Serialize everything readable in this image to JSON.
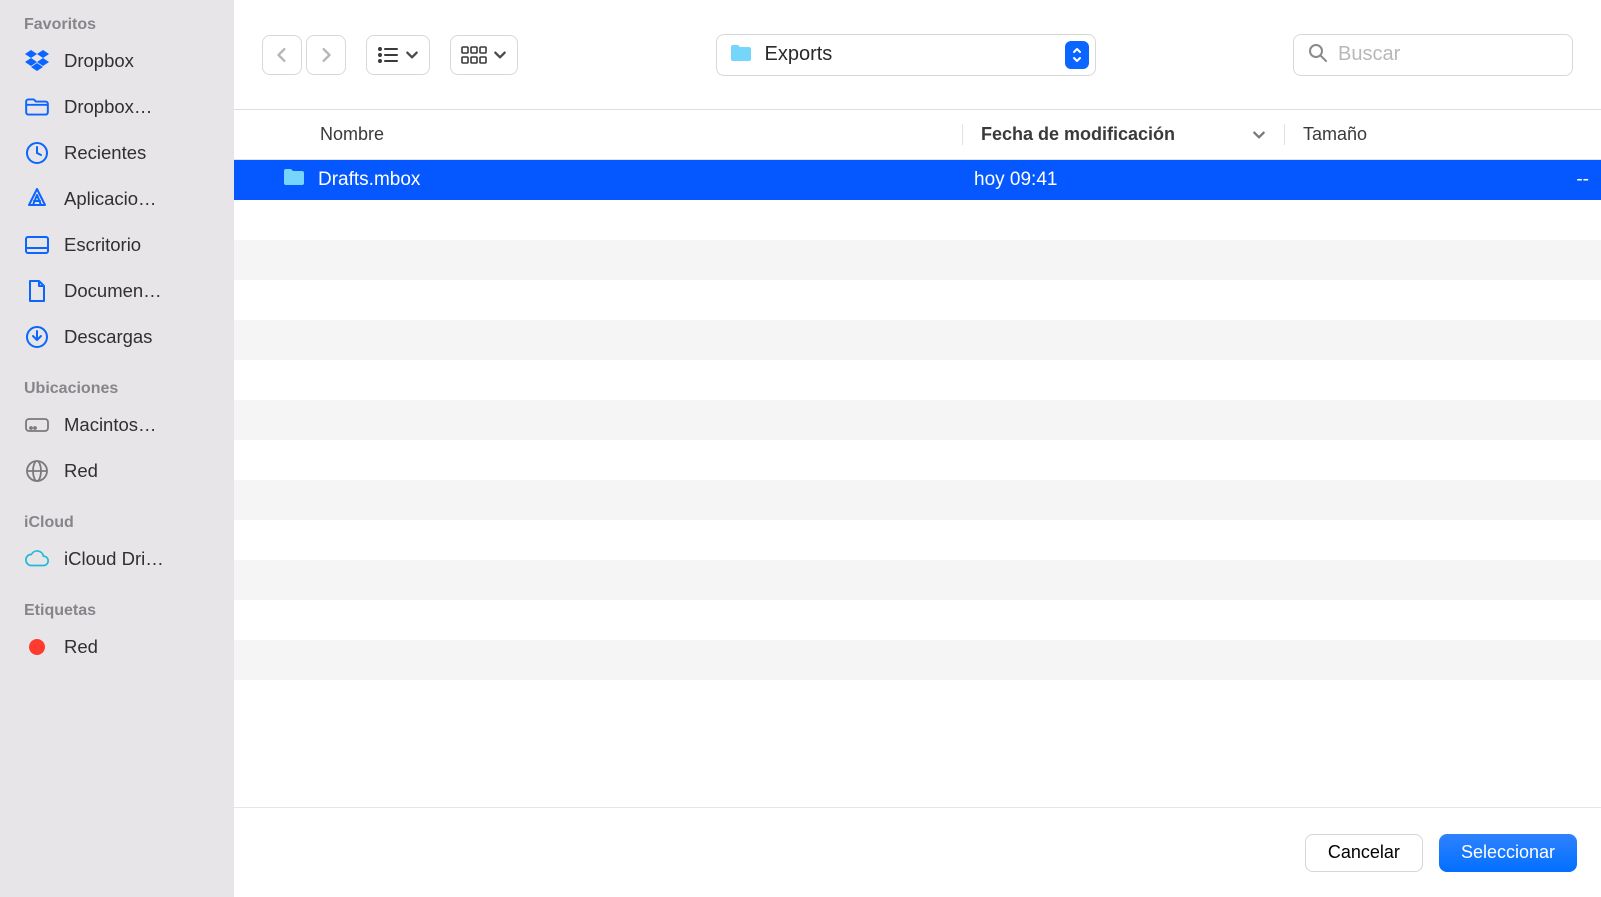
{
  "sidebar": {
    "sections": [
      {
        "title": "Favoritos",
        "items": [
          {
            "icon": "dropbox",
            "label": "Dropbox",
            "color": "#0a66ff"
          },
          {
            "icon": "folder-open",
            "label": "Dropbox…",
            "color": "#0a66ff"
          },
          {
            "icon": "clock",
            "label": "Recientes",
            "color": "#0a66ff"
          },
          {
            "icon": "apps",
            "label": "Aplicacio…",
            "color": "#0a66ff"
          },
          {
            "icon": "desktop",
            "label": "Escritorio",
            "color": "#0a66ff"
          },
          {
            "icon": "document",
            "label": "Documen…",
            "color": "#0a66ff"
          },
          {
            "icon": "download",
            "label": "Descargas",
            "color": "#0a66ff"
          }
        ]
      },
      {
        "title": "Ubicaciones",
        "items": [
          {
            "icon": "hdd",
            "label": "Macintos…",
            "color": "#7a7a7a"
          },
          {
            "icon": "network",
            "label": "Red",
            "color": "#7a7a7a"
          }
        ]
      },
      {
        "title": "iCloud",
        "items": [
          {
            "icon": "cloud",
            "label": "iCloud Dri…",
            "color": "#1fbad6"
          }
        ]
      },
      {
        "title": "Etiquetas",
        "items": [
          {
            "icon": "tag-dot",
            "label": "Red",
            "color": "#ff3b30"
          }
        ]
      }
    ]
  },
  "toolbar": {
    "folder_name": "Exports",
    "search_placeholder": "Buscar"
  },
  "columns": {
    "name": "Nombre",
    "date": "Fecha de modificación",
    "size": "Tamaño"
  },
  "files": [
    {
      "name": "Drafts.mbox",
      "date": "hoy 09:41",
      "size": "--",
      "selected": true
    }
  ],
  "footer": {
    "cancel": "Cancelar",
    "select": "Seleccionar"
  },
  "empty_rows": 13
}
